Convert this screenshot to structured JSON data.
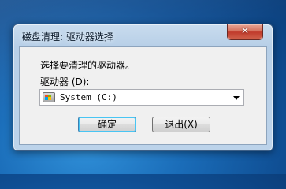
{
  "dialog": {
    "title": "磁盘清理: 驱动器选择",
    "close_symbol": "✕",
    "prompt": "选择要清理的驱动器。",
    "drive_label": "驱动器 (D):",
    "selected_drive": "System (C:)",
    "ok_label": "确定",
    "exit_label": "退出(X)"
  },
  "colors": {
    "desktop": "#1a6cb8",
    "close_button": "#c0392b",
    "default_button_border": "#3c7fb1"
  },
  "icons": {
    "drive": "windows-drive-icon",
    "dropdown": "dropdown-arrow-icon"
  }
}
